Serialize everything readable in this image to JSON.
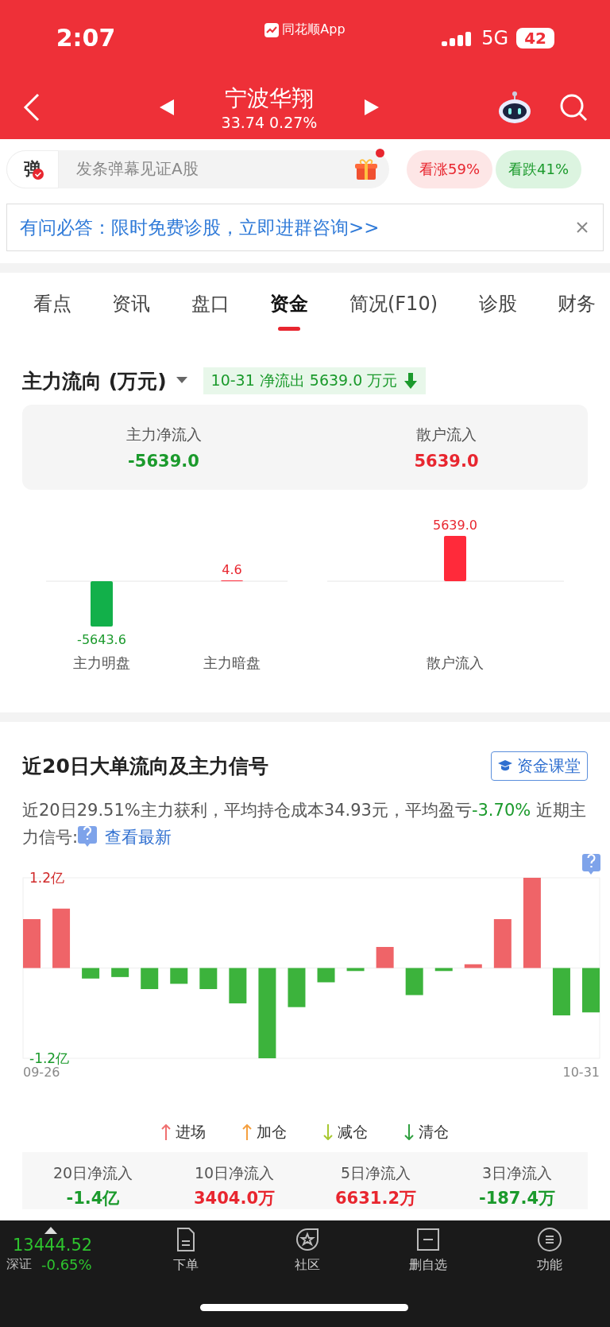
{
  "status_bar": {
    "time": "2:07",
    "app": "同花顺App",
    "network": "5G",
    "battery": "42"
  },
  "nav": {
    "title": "宁波华翔",
    "price": "33.74 0.27%"
  },
  "danmaku": {
    "badge": "弹",
    "placeholder": "发条弹幕见证A股",
    "has_notification": true
  },
  "sentiment": [
    {
      "label": "看涨59%",
      "kind": "up"
    },
    {
      "label": "看跌41%",
      "kind": "down"
    }
  ],
  "banner": {
    "text": "有问必答：限时免费诊股，立即进群咨询>>"
  },
  "tabs": [
    {
      "label": "看点",
      "selected": false
    },
    {
      "label": "资讯",
      "selected": false
    },
    {
      "label": "盘口",
      "selected": false
    },
    {
      "label": "资金",
      "selected": true
    },
    {
      "label": "简况(F10)",
      "selected": false
    },
    {
      "label": "诊股",
      "selected": false
    },
    {
      "label": "财务",
      "selected": false
    }
  ],
  "flow": {
    "title": "主力流向 (万元)",
    "tag": "10-31 净流出 5639.0 万元",
    "summary": [
      {
        "label": "主力净流入",
        "value": "-5639.0",
        "kind": "fall"
      },
      {
        "label": "散户流入",
        "value": "5639.0",
        "kind": "rise"
      }
    ],
    "charts": [
      {
        "chart_data": {
          "type": "bar",
          "categories": [
            "主力明盘",
            "主力暗盘"
          ],
          "values": [
            -5643.6,
            4.6
          ],
          "value_labels": [
            "-5643.6",
            "4.6"
          ]
        }
      },
      {
        "chart_data": {
          "type": "bar",
          "categories": [
            "散户流入"
          ],
          "values": [
            5639.0
          ],
          "value_labels": [
            "5639.0"
          ]
        }
      }
    ]
  },
  "signals": {
    "title": "近20日大单流向及主力信号",
    "button": "资金课堂",
    "summary": "近20日29.51%主力获利，平均持仓成本34.93元，平均盈亏",
    "profit": "-3.70%",
    "signal_label": "近期主力信号:",
    "link": "查看最新",
    "start_date": "09-26",
    "end_date": "10-31",
    "chart_data": {
      "type": "bar",
      "ylim": [
        -1.2,
        1.2
      ],
      "yticks": [
        {
          "value": 1.2,
          "label": "1.2亿"
        },
        {
          "value": -1.2,
          "label": "-1.2亿"
        }
      ],
      "values": [
        0.65,
        0.79,
        -0.14,
        -0.12,
        -0.28,
        -0.21,
        -0.28,
        -0.47,
        -1.2,
        -0.52,
        -0.19,
        -0.04,
        0.28,
        -0.36,
        -0.04,
        0.05,
        0.65,
        1.2,
        -0.63,
        -0.59
      ]
    },
    "legend": [
      {
        "label": "进场",
        "kind": "up",
        "color": "#f07070"
      },
      {
        "label": "加仓",
        "kind": "up",
        "color": "#f5a040"
      },
      {
        "label": "减仓",
        "kind": "down",
        "color": "#a8c830"
      },
      {
        "label": "清仓",
        "kind": "down",
        "color": "#30a040"
      }
    ],
    "stats": [
      {
        "label": "20日净流入",
        "value": "-1.4亿",
        "kind": "fall"
      },
      {
        "label": "10日净流入",
        "value": "3404.0万",
        "kind": "rise"
      },
      {
        "label": "5日净流入",
        "value": "6631.2万",
        "kind": "rise"
      },
      {
        "label": "3日净流入",
        "value": "-187.4万",
        "kind": "fall"
      }
    ]
  },
  "bottom_nav": {
    "index": {
      "value": "13444.52",
      "name": "深证",
      "change": "-0.65%",
      "kind": "fall"
    },
    "items": [
      {
        "label": "下单",
        "kind": "order"
      },
      {
        "label": "社区",
        "kind": "community"
      },
      {
        "label": "删自选",
        "kind": "remove"
      },
      {
        "label": "功能",
        "kind": "menu"
      }
    ]
  }
}
